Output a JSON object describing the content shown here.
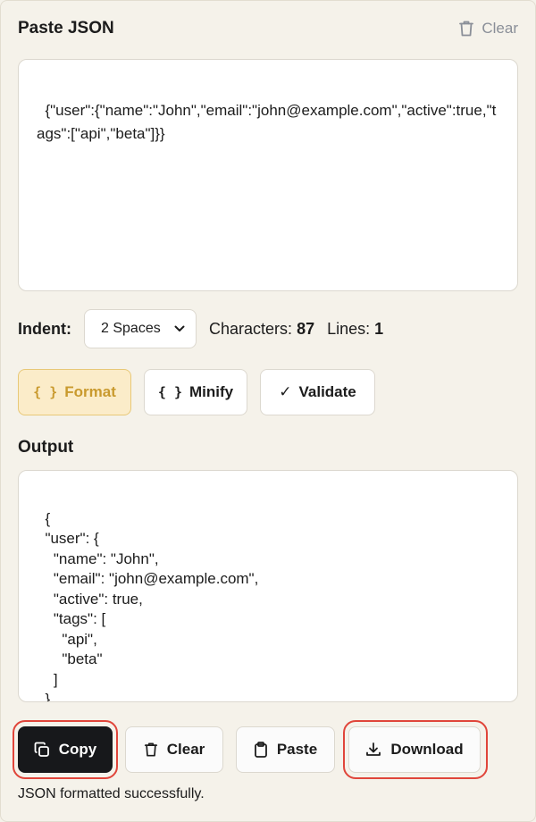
{
  "header": {
    "title": "Paste JSON",
    "clear_label": "Clear"
  },
  "input": {
    "value": "{\"user\":{\"name\":\"John\",\"email\":\"john@example.com\",\"active\":true,\"tags\":[\"api\",\"beta\"]}}"
  },
  "controls": {
    "indent_label": "Indent:",
    "indent_value": "2 Spaces",
    "characters_label": "Characters:",
    "characters_value": "87",
    "lines_label": "Lines:",
    "lines_value": "1"
  },
  "actions": {
    "format_icon": "{ }",
    "format_label": "Format",
    "minify_icon": "{ }",
    "minify_label": "Minify",
    "validate_icon": "✓",
    "validate_label": "Validate"
  },
  "output": {
    "label": "Output",
    "value": "{\n  \"user\": {\n    \"name\": \"John\",\n    \"email\": \"john@example.com\",\n    \"active\": true,\n    \"tags\": [\n      \"api\",\n      \"beta\"\n    ]\n  }\n}"
  },
  "bottom": {
    "copy_label": "Copy",
    "clear_label": "Clear",
    "paste_label": "Paste",
    "download_label": "Download"
  },
  "status": {
    "message": "JSON formatted successfully."
  },
  "colors": {
    "background": "#f5f2ea",
    "accent_format": "#fbecc9",
    "accent_ring": "#e0453a",
    "copy_button": "#17181b"
  },
  "icons": {
    "clear": "trash-icon",
    "copy": "copy-icon",
    "paste": "clipboard-icon",
    "download": "download-icon",
    "select": "chevron-down-icon"
  }
}
